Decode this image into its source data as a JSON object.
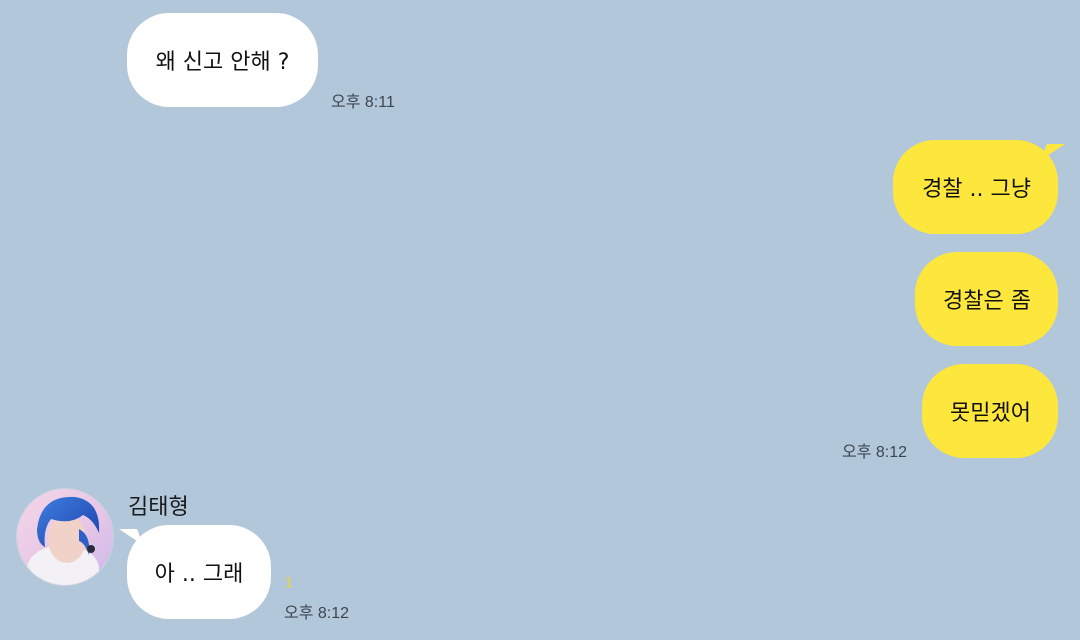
{
  "chat": {
    "msg1": {
      "text": "왜 신고 안해 ?",
      "time": "오후 8:11"
    },
    "msg2": {
      "text": "경찰 .. 그냥"
    },
    "msg3": {
      "text": "경찰은 좀"
    },
    "msg4": {
      "text": "못믿겠어",
      "time": "오후 8:12"
    },
    "msg5": {
      "sender": "김태형",
      "text": "아 .. 그래",
      "unread": "1",
      "time": "오후 8:12"
    }
  },
  "colors": {
    "background": "#b2c7da",
    "outgoing_bubble": "#fee73c",
    "incoming_bubble": "#ffffff",
    "unread_count": "#f2d531"
  },
  "icons": {
    "avatar": "profile-photo-blue-hair"
  }
}
